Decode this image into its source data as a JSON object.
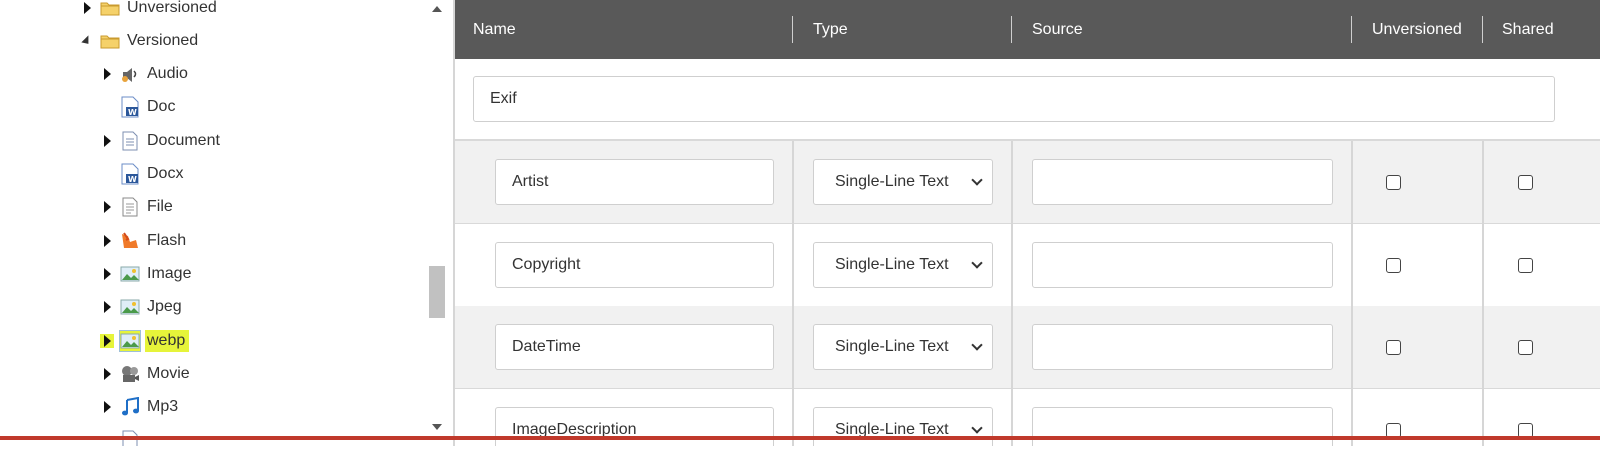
{
  "tree": {
    "items": [
      {
        "label": "Unversioned",
        "icon": "folder-icon",
        "expander": "collapsed"
      },
      {
        "label": "Versioned",
        "icon": "folder-icon",
        "expander": "expanded"
      },
      {
        "label": "Audio",
        "icon": "speaker-icon",
        "expander": "collapsed"
      },
      {
        "label": "Doc",
        "icon": "word-doc-icon",
        "expander": "none"
      },
      {
        "label": "Document",
        "icon": "document-icon",
        "expander": "collapsed"
      },
      {
        "label": "Docx",
        "icon": "word-doc-icon",
        "expander": "none"
      },
      {
        "label": "File",
        "icon": "file-icon",
        "expander": "collapsed"
      },
      {
        "label": "Flash",
        "icon": "flash-icon",
        "expander": "collapsed"
      },
      {
        "label": "Image",
        "icon": "image-icon",
        "expander": "collapsed"
      },
      {
        "label": "Jpeg",
        "icon": "image-icon",
        "expander": "collapsed"
      },
      {
        "label": "webp",
        "icon": "image-icon",
        "expander": "collapsed",
        "highlighted": true
      },
      {
        "label": "Movie",
        "icon": "film-reel-icon",
        "expander": "collapsed"
      },
      {
        "label": "Mp3",
        "icon": "music-note-icon",
        "expander": "collapsed"
      }
    ]
  },
  "grid": {
    "columns": {
      "name": "Name",
      "type": "Type",
      "source": "Source",
      "unversioned": "Unversioned",
      "shared": "Shared"
    },
    "group_value": "Exif",
    "rows": [
      {
        "name": "Artist",
        "type": "Single-Line Text",
        "source": "",
        "unversioned": false,
        "shared": false
      },
      {
        "name": "Copyright",
        "type": "Single-Line Text",
        "source": "",
        "unversioned": false,
        "shared": false
      },
      {
        "name": "DateTime",
        "type": "Single-Line Text",
        "source": "",
        "unversioned": false,
        "shared": false
      },
      {
        "name": "ImageDescription",
        "type": "Single-Line Text",
        "source": "",
        "unversioned": false,
        "shared": false
      }
    ]
  },
  "colors": {
    "header_bg": "#595959",
    "highlight": "#e6f43a",
    "row_alt_bg": "#f1f1f1"
  }
}
